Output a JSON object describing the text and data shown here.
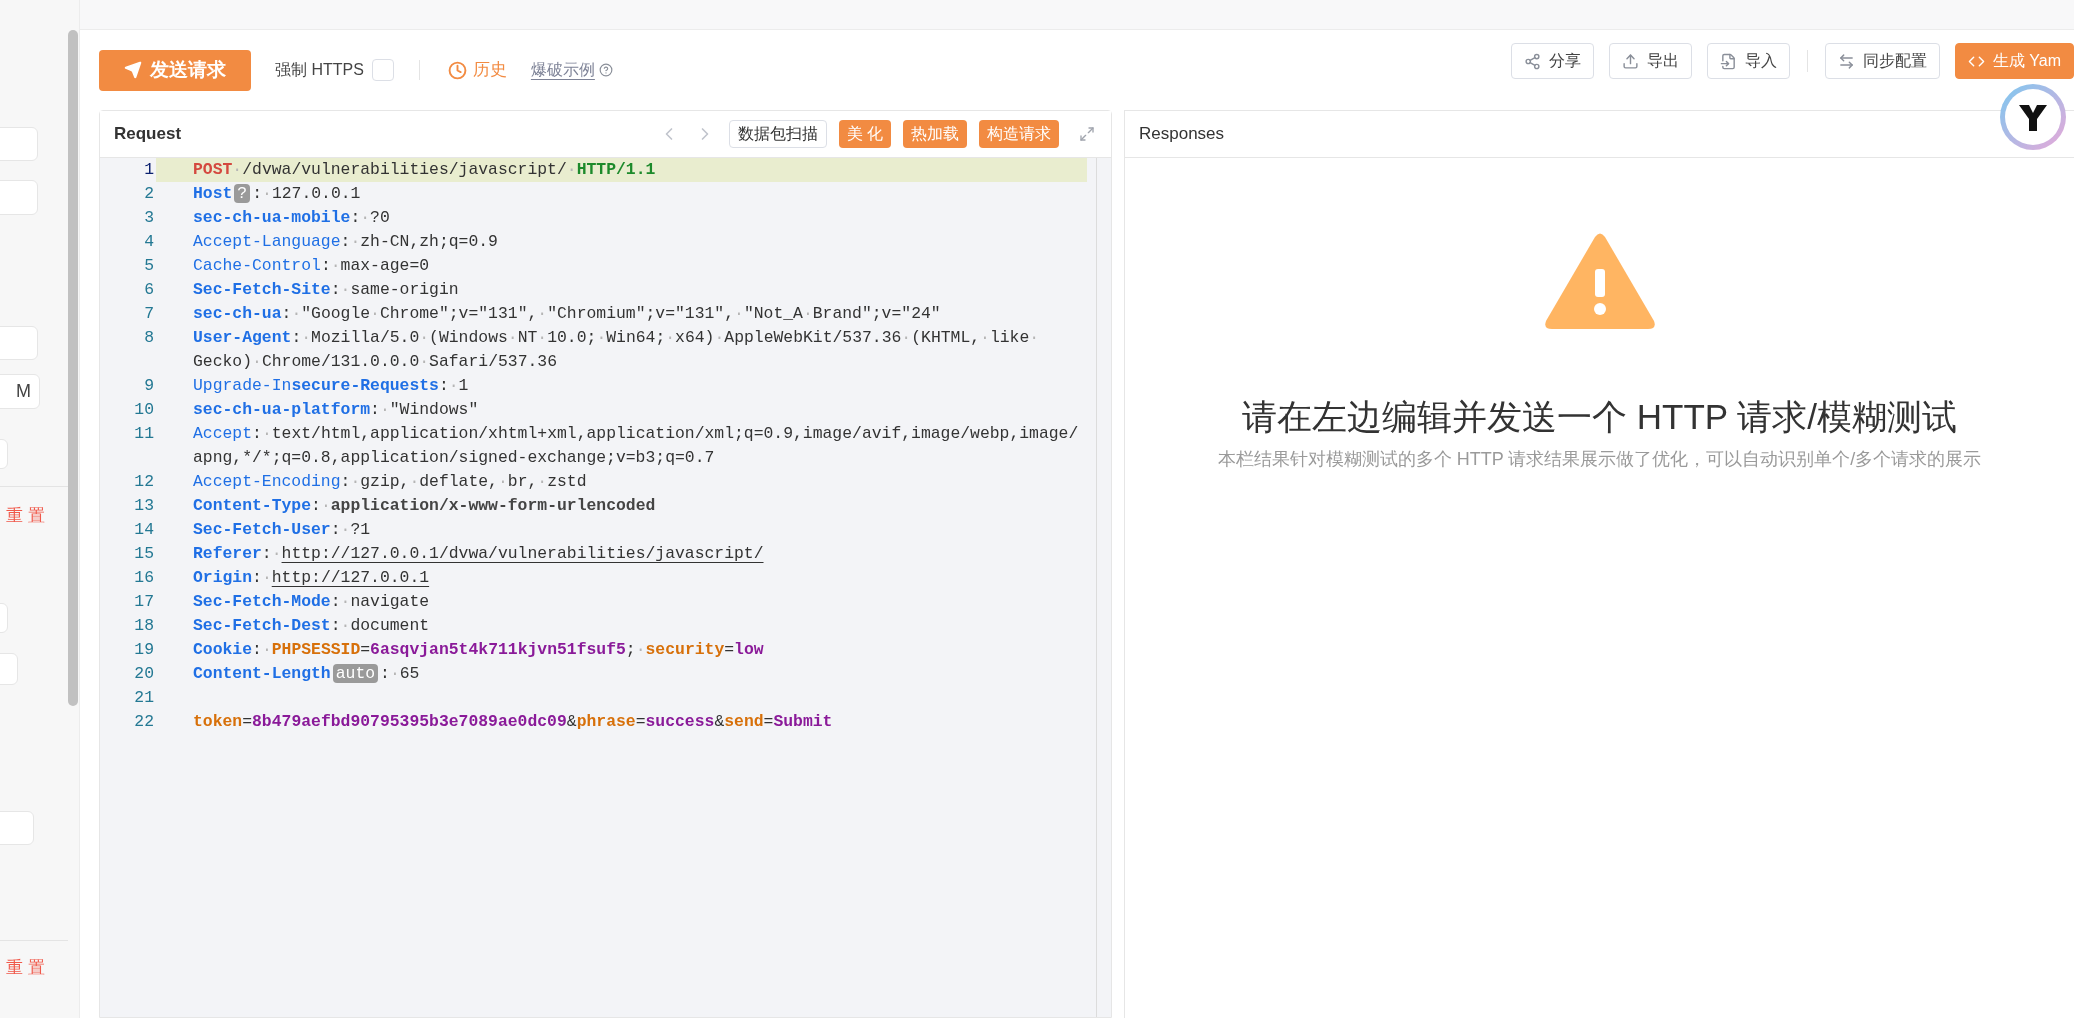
{
  "sidebar": {
    "items": [
      {
        "kind": "field"
      },
      {
        "kind": "field"
      },
      {
        "kind": "field"
      },
      {
        "kind": "field",
        "value": "M"
      },
      {
        "kind": "field"
      },
      {
        "kind": "divider"
      },
      {
        "kind": "reset",
        "text": "重 置"
      },
      {
        "kind": "field"
      },
      {
        "kind": "field"
      },
      {
        "kind": "field"
      },
      {
        "kind": "divider"
      },
      {
        "kind": "reset",
        "text": "重 置"
      }
    ]
  },
  "toolbar": {
    "send_button": "发送请求",
    "force_https": {
      "label": "强制 HTTPS",
      "checked": false
    },
    "history": "历史",
    "example_link": "爆破示例",
    "actions": [
      {
        "label": "分享",
        "kind": "default"
      },
      {
        "label": "导出",
        "kind": "default"
      },
      {
        "label": "导入",
        "kind": "default"
      },
      {
        "label": "同步配置",
        "kind": "default"
      },
      {
        "label": "生成 Yam",
        "kind": "primary"
      }
    ]
  },
  "request": {
    "title": "Request",
    "buttons": [
      {
        "label": "数据包扫描",
        "kind": "outline"
      },
      {
        "label": "美 化",
        "kind": "primary"
      },
      {
        "label": "热加载",
        "kind": "primary"
      },
      {
        "label": "构造请求",
        "kind": "primary"
      }
    ],
    "lines": [
      {
        "n": "1",
        "active": true,
        "segments": [
          [
            {
              "kind": "method",
              "text": "POST"
            },
            {
              "kind": "ws",
              "text": "·"
            },
            {
              "kind": "text",
              "text": "/dvwa/vulnerabilities/javascript/"
            },
            {
              "kind": "ws",
              "text": "·"
            },
            {
              "kind": "version",
              "text": "HTTP/1.1"
            }
          ]
        ]
      },
      {
        "n": "2",
        "active": false,
        "segments": [
          [
            {
              "kind": "keyb",
              "text": "Host"
            },
            {
              "kind": "badge",
              "text": "?"
            },
            {
              "kind": "text",
              "text": ":"
            },
            {
              "kind": "ws",
              "text": "·"
            },
            {
              "kind": "text",
              "text": "127.0.0.1"
            }
          ]
        ]
      },
      {
        "n": "3",
        "active": false,
        "segments": [
          [
            {
              "kind": "keyb",
              "text": "sec-ch-ua-mobile"
            },
            {
              "kind": "text",
              "text": ":"
            },
            {
              "kind": "ws",
              "text": "·"
            },
            {
              "kind": "text",
              "text": "?0"
            }
          ]
        ]
      },
      {
        "n": "4",
        "active": false,
        "segments": [
          [
            {
              "kind": "key",
              "text": "Accept-Language"
            },
            {
              "kind": "text",
              "text": ":"
            },
            {
              "kind": "ws",
              "text": "·"
            },
            {
              "kind": "text",
              "text": "zh-CN,zh;q=0.9"
            }
          ]
        ]
      },
      {
        "n": "5",
        "active": false,
        "segments": [
          [
            {
              "kind": "key",
              "text": "Cache-Control"
            },
            {
              "kind": "text",
              "text": ":"
            },
            {
              "kind": "ws",
              "text": "·"
            },
            {
              "kind": "text",
              "text": "max-age=0"
            }
          ]
        ]
      },
      {
        "n": "6",
        "active": false,
        "segments": [
          [
            {
              "kind": "keyb",
              "text": "Sec-Fetch-Site"
            },
            {
              "kind": "text",
              "text": ":"
            },
            {
              "kind": "ws",
              "text": "·"
            },
            {
              "kind": "text",
              "text": "same-origin"
            }
          ]
        ]
      },
      {
        "n": "7",
        "active": false,
        "segments": [
          [
            {
              "kind": "keyb",
              "text": "sec-ch-ua"
            },
            {
              "kind": "text",
              "text": ":"
            },
            {
              "kind": "ws",
              "text": "·"
            },
            {
              "kind": "text",
              "text": "\"Google"
            },
            {
              "kind": "ws",
              "text": "·"
            },
            {
              "kind": "text",
              "text": "Chrome\";v=\"131\","
            },
            {
              "kind": "ws",
              "text": "·"
            },
            {
              "kind": "text",
              "text": "\"Chromium\";v=\"131\","
            },
            {
              "kind": "ws",
              "text": "·"
            },
            {
              "kind": "text",
              "text": "\"Not_A"
            },
            {
              "kind": "ws",
              "text": "·"
            },
            {
              "kind": "text",
              "text": "Brand\";v=\"24\""
            }
          ]
        ]
      },
      {
        "n": "8",
        "active": false,
        "segments": [
          [
            {
              "kind": "keyb",
              "text": "User-Agent"
            },
            {
              "kind": "text",
              "text": ":"
            },
            {
              "kind": "ws",
              "text": "·"
            },
            {
              "kind": "text",
              "text": "Mozilla/5.0"
            },
            {
              "kind": "ws",
              "text": "·"
            },
            {
              "kind": "text",
              "text": "(Windows"
            },
            {
              "kind": "ws",
              "text": "·"
            },
            {
              "kind": "text",
              "text": "NT"
            },
            {
              "kind": "ws",
              "text": "·"
            },
            {
              "kind": "text",
              "text": "10.0;"
            },
            {
              "kind": "ws",
              "text": "·"
            },
            {
              "kind": "text",
              "text": "Win64;"
            },
            {
              "kind": "ws",
              "text": "·"
            },
            {
              "kind": "text",
              "text": "x64)"
            },
            {
              "kind": "ws",
              "text": "·"
            },
            {
              "kind": "text",
              "text": "AppleWebKit/537.36"
            },
            {
              "kind": "ws",
              "text": "·"
            },
            {
              "kind": "text",
              "text": "(KHTML,"
            },
            {
              "kind": "ws",
              "text": "·"
            },
            {
              "kind": "text",
              "text": "like"
            },
            {
              "kind": "ws",
              "text": "·"
            }
          ],
          [
            {
              "kind": "text",
              "text": "Gecko)"
            },
            {
              "kind": "ws",
              "text": "·"
            },
            {
              "kind": "text",
              "text": "Chrome/131.0.0.0"
            },
            {
              "kind": "ws",
              "text": "·"
            },
            {
              "kind": "text",
              "text": "Safari/537.36"
            }
          ]
        ]
      },
      {
        "n": "9",
        "active": false,
        "segments": [
          [
            {
              "kind": "key",
              "text": "Upgrade-In"
            },
            {
              "kind": "keyb",
              "text": "secure-Requests"
            },
            {
              "kind": "text",
              "text": ":"
            },
            {
              "kind": "ws",
              "text": "·"
            },
            {
              "kind": "text",
              "text": "1"
            }
          ]
        ]
      },
      {
        "n": "10",
        "active": false,
        "segments": [
          [
            {
              "kind": "keyb",
              "text": "sec-ch-ua-platform"
            },
            {
              "kind": "text",
              "text": ":"
            },
            {
              "kind": "ws",
              "text": "·"
            },
            {
              "kind": "text",
              "text": "\"Windows\""
            }
          ]
        ]
      },
      {
        "n": "11",
        "active": false,
        "segments": [
          [
            {
              "kind": "key",
              "text": "Accept"
            },
            {
              "kind": "text",
              "text": ":"
            },
            {
              "kind": "ws",
              "text": "·"
            },
            {
              "kind": "text",
              "text": "text/html,application/xhtml+xml,application/xml;q=0.9,image/avif,image/webp,image/"
            }
          ],
          [
            {
              "kind": "text",
              "text": "apng,*/*;q=0.8,application/signed-exchange;v=b3;q=0.7"
            }
          ]
        ]
      },
      {
        "n": "12",
        "active": false,
        "segments": [
          [
            {
              "kind": "key",
              "text": "Accept-Encoding"
            },
            {
              "kind": "text",
              "text": ":"
            },
            {
              "kind": "ws",
              "text": "·"
            },
            {
              "kind": "text",
              "text": "gzip,"
            },
            {
              "kind": "ws",
              "text": "·"
            },
            {
              "kind": "text",
              "text": "deflate,"
            },
            {
              "kind": "ws",
              "text": "·"
            },
            {
              "kind": "text",
              "text": "br,"
            },
            {
              "kind": "ws",
              "text": "·"
            },
            {
              "kind": "text",
              "text": "zstd"
            }
          ]
        ]
      },
      {
        "n": "13",
        "active": false,
        "segments": [
          [
            {
              "kind": "keyb",
              "text": "Content-Type"
            },
            {
              "kind": "text",
              "text": ":"
            },
            {
              "kind": "ws",
              "text": "·"
            },
            {
              "kind": "valb",
              "text": "application/x-www-form-urlencoded"
            }
          ]
        ]
      },
      {
        "n": "14",
        "active": false,
        "segments": [
          [
            {
              "kind": "keyb",
              "text": "Sec-Fetch-User"
            },
            {
              "kind": "text",
              "text": ":"
            },
            {
              "kind": "ws",
              "text": "·"
            },
            {
              "kind": "text",
              "text": "?1"
            }
          ]
        ]
      },
      {
        "n": "15",
        "active": false,
        "segments": [
          [
            {
              "kind": "keyb",
              "text": "Referer"
            },
            {
              "kind": "text",
              "text": ":"
            },
            {
              "kind": "ws",
              "text": "·"
            },
            {
              "kind": "link",
              "text": "http://127.0.0.1/dvwa/vulnerabilities/javascript/"
            }
          ]
        ]
      },
      {
        "n": "16",
        "active": false,
        "segments": [
          [
            {
              "kind": "keyb",
              "text": "Origin"
            },
            {
              "kind": "text",
              "text": ":"
            },
            {
              "kind": "ws",
              "text": "·"
            },
            {
              "kind": "link",
              "text": "http://127.0.0.1"
            }
          ]
        ]
      },
      {
        "n": "17",
        "active": false,
        "segments": [
          [
            {
              "kind": "keyb",
              "text": "Sec-Fetch-Mode"
            },
            {
              "kind": "text",
              "text": ":"
            },
            {
              "kind": "ws",
              "text": "·"
            },
            {
              "kind": "text",
              "text": "navigate"
            }
          ]
        ]
      },
      {
        "n": "18",
        "active": false,
        "segments": [
          [
            {
              "kind": "keyb",
              "text": "Sec-Fetch-Dest"
            },
            {
              "kind": "text",
              "text": ":"
            },
            {
              "kind": "ws",
              "text": "·"
            },
            {
              "kind": "text",
              "text": "document"
            }
          ]
        ]
      },
      {
        "n": "19",
        "active": false,
        "segments": [
          [
            {
              "kind": "keyb",
              "text": "Cookie"
            },
            {
              "kind": "text",
              "text": ":"
            },
            {
              "kind": "ws",
              "text": "·"
            },
            {
              "kind": "pkey",
              "text": "PHPSESSID"
            },
            {
              "kind": "text",
              "text": "="
            },
            {
              "kind": "pval",
              "text": "6asqvjan5t4k711kjvn51fsuf5"
            },
            {
              "kind": "text",
              "text": ";"
            },
            {
              "kind": "ws",
              "text": "·"
            },
            {
              "kind": "pkey",
              "text": "security"
            },
            {
              "kind": "text",
              "text": "="
            },
            {
              "kind": "pval",
              "text": "low"
            }
          ]
        ]
      },
      {
        "n": "20",
        "active": false,
        "segments": [
          [
            {
              "kind": "keyb",
              "text": "Content-Length"
            },
            {
              "kind": "badge",
              "text": "auto"
            },
            {
              "kind": "text",
              "text": ":"
            },
            {
              "kind": "ws",
              "text": "·"
            },
            {
              "kind": "text",
              "text": "65"
            }
          ]
        ]
      },
      {
        "n": "21",
        "active": false
      },
      {
        "n": "22",
        "active": false,
        "segments": [
          [
            {
              "kind": "pkey",
              "text": "token"
            },
            {
              "kind": "text",
              "text": "="
            },
            {
              "kind": "pval",
              "text": "8b479aefbd90795395b3e7089ae0dc09"
            },
            {
              "kind": "text",
              "text": "&"
            },
            {
              "kind": "pkey",
              "text": "phrase"
            },
            {
              "kind": "text",
              "text": "="
            },
            {
              "kind": "pval",
              "text": "success"
            },
            {
              "kind": "text",
              "text": "&"
            },
            {
              "kind": "pkey",
              "text": "send"
            },
            {
              "kind": "text",
              "text": "="
            },
            {
              "kind": "pval",
              "text": "Submit"
            }
          ]
        ]
      }
    ]
  },
  "responses": {
    "title": "Responses",
    "empty_title": "请在左边编辑并发送一个 HTTP 请求/模糊测试",
    "empty_hint": "本栏结果针对模糊测试的多个 HTTP 请求结果展示做了优化，可以自动识别单个/多个请求的展示"
  }
}
